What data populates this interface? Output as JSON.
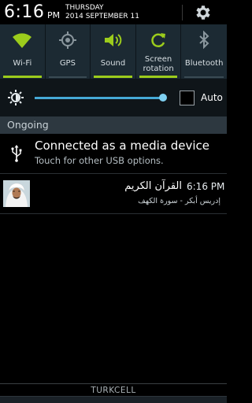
{
  "status": {
    "time": "6:16",
    "ampm": "PM",
    "day": "THURSDAY",
    "date": "2014 SEPTEMBER 11",
    "settings_icon": "gear-icon"
  },
  "toggles": [
    {
      "label": "Wi-Fi",
      "icon": "wifi-icon",
      "on": true
    },
    {
      "label": "GPS",
      "icon": "gps-icon",
      "on": false
    },
    {
      "label": "Sound",
      "icon": "sound-icon",
      "on": true
    },
    {
      "label": "Screen rotation",
      "icon": "rotation-icon",
      "on": true
    },
    {
      "label": "Bluetooth",
      "icon": "bluetooth-icon",
      "on": false
    }
  ],
  "brightness": {
    "level": 0.98,
    "auto_label": "Auto",
    "auto_checked": false
  },
  "section": {
    "title": "Ongoing"
  },
  "notifications": {
    "usb": {
      "title": "Connected as a media device",
      "subtitle": "Touch for other USB options.",
      "icon": "usb-icon"
    },
    "quran": {
      "title": "القرآن الكريم",
      "time": "6:16 PM",
      "subtitle": "إدريس أبكر - سورة الكهف"
    }
  },
  "footer": {
    "carrier": "TURKCELL"
  },
  "colors": {
    "accent_on": "#9ccc1c",
    "slider": "#45a9d6",
    "toggle_bg": "#1c2a33"
  }
}
